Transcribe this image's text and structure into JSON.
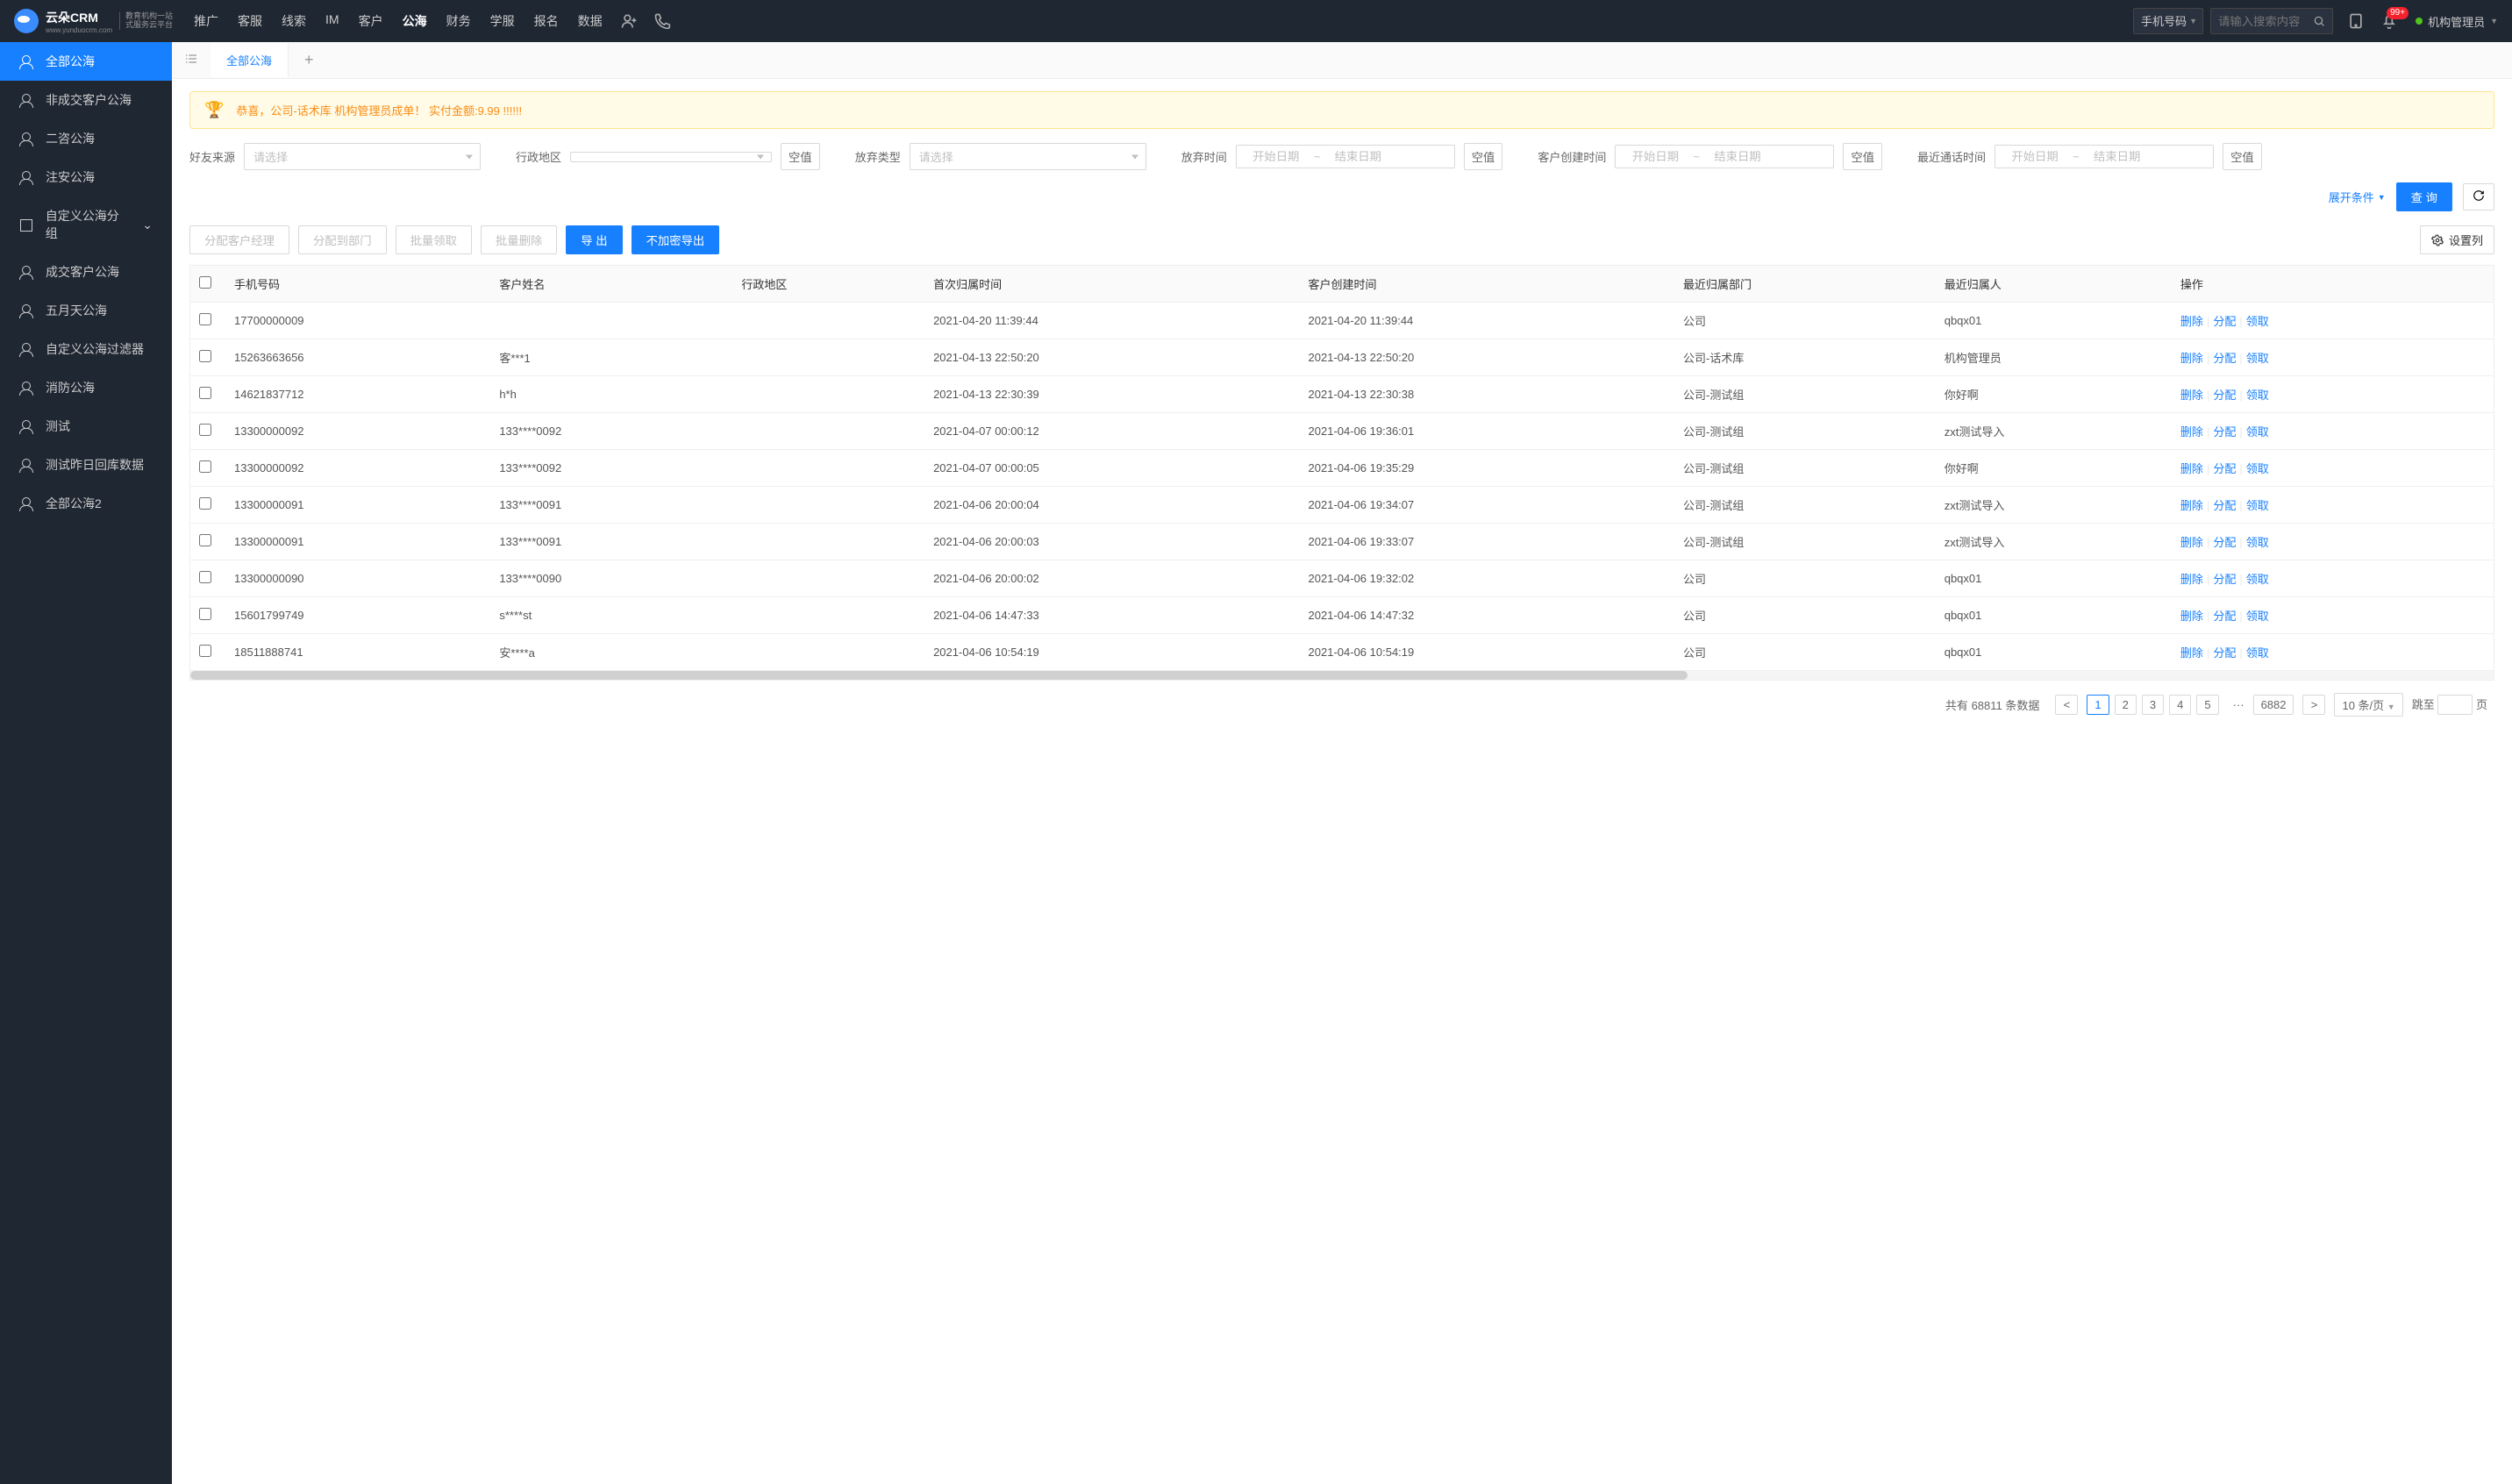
{
  "logo": {
    "brand": "云朵CRM",
    "url": "www.yunduocrm.com",
    "sub1": "教育机构一站",
    "sub2": "式服务云平台"
  },
  "topnav": {
    "items": [
      "推广",
      "客服",
      "线索",
      "IM",
      "客户",
      "公海",
      "财务",
      "学服",
      "报名",
      "数据"
    ],
    "active_index": 5,
    "search_type": "手机号码",
    "search_placeholder": "请输入搜索内容",
    "user": "机构管理员",
    "badge": "99+"
  },
  "sidebar": {
    "items": [
      {
        "label": "全部公海",
        "icon": "people"
      },
      {
        "label": "非成交客户公海",
        "icon": "people"
      },
      {
        "label": "二咨公海",
        "icon": "people"
      },
      {
        "label": "注安公海",
        "icon": "people"
      },
      {
        "label": "自定义公海分组",
        "icon": "square",
        "expandable": true
      },
      {
        "label": "成交客户公海",
        "icon": "people"
      },
      {
        "label": "五月天公海",
        "icon": "people"
      },
      {
        "label": "自定义公海过滤器",
        "icon": "people"
      },
      {
        "label": "消防公海",
        "icon": "people"
      },
      {
        "label": "测试",
        "icon": "people"
      },
      {
        "label": "测试昨日回库数据",
        "icon": "people"
      },
      {
        "label": "全部公海2",
        "icon": "people"
      }
    ],
    "active_index": 0
  },
  "tab": {
    "label": "全部公海"
  },
  "banner": "恭喜，公司-话术库  机构管理员成单！  实付金额:9.99 !!!!!!",
  "filters": {
    "friend_source": {
      "label": "好友来源",
      "placeholder": "请选择"
    },
    "admin_region": {
      "label": "行政地区",
      "placeholder": "",
      "null_btn": "空值"
    },
    "abandon_type": {
      "label": "放弃类型",
      "placeholder": "请选择"
    },
    "abandon_time": {
      "label": "放弃时间",
      "start": "开始日期",
      "end": "结束日期",
      "null_btn": "空值"
    },
    "create_time": {
      "label": "客户创建时间",
      "start": "开始日期",
      "end": "结束日期",
      "null_btn": "空值"
    },
    "last_call": {
      "label": "最近通话时间",
      "start": "开始日期",
      "end": "结束日期",
      "null_btn": "空值"
    },
    "expand": "展开条件",
    "query": "查 询"
  },
  "actions": {
    "assign_mgr": "分配客户经理",
    "assign_dept": "分配到部门",
    "batch_claim": "批量领取",
    "batch_delete": "批量删除",
    "export": "导 出",
    "export_plain": "不加密导出",
    "col_settings": "设置列"
  },
  "table": {
    "headers": [
      "手机号码",
      "客户姓名",
      "行政地区",
      "首次归属时间",
      "客户创建时间",
      "最近归属部门",
      "最近归属人",
      "操作"
    ],
    "row_actions": {
      "delete": "删除",
      "assign": "分配",
      "claim": "领取"
    },
    "rows": [
      {
        "phone": "17700000009",
        "name": "",
        "region": "",
        "first_time": "2021-04-20 11:39:44",
        "create_time": "2021-04-20 11:39:44",
        "dept": "公司",
        "owner": "qbqx01"
      },
      {
        "phone": "15263663656",
        "name": "客***1",
        "region": "",
        "first_time": "2021-04-13 22:50:20",
        "create_time": "2021-04-13 22:50:20",
        "dept": "公司-话术库",
        "owner": "机构管理员"
      },
      {
        "phone": "14621837712",
        "name": "h*h",
        "region": "",
        "first_time": "2021-04-13 22:30:39",
        "create_time": "2021-04-13 22:30:38",
        "dept": "公司-测试组",
        "owner": "你好啊"
      },
      {
        "phone": "13300000092",
        "name": "133****0092",
        "region": "",
        "first_time": "2021-04-07 00:00:12",
        "create_time": "2021-04-06 19:36:01",
        "dept": "公司-测试组",
        "owner": "zxt测试导入"
      },
      {
        "phone": "13300000092",
        "name": "133****0092",
        "region": "",
        "first_time": "2021-04-07 00:00:05",
        "create_time": "2021-04-06 19:35:29",
        "dept": "公司-测试组",
        "owner": "你好啊"
      },
      {
        "phone": "13300000091",
        "name": "133****0091",
        "region": "",
        "first_time": "2021-04-06 20:00:04",
        "create_time": "2021-04-06 19:34:07",
        "dept": "公司-测试组",
        "owner": "zxt测试导入"
      },
      {
        "phone": "13300000091",
        "name": "133****0091",
        "region": "",
        "first_time": "2021-04-06 20:00:03",
        "create_time": "2021-04-06 19:33:07",
        "dept": "公司-测试组",
        "owner": "zxt测试导入"
      },
      {
        "phone": "13300000090",
        "name": "133****0090",
        "region": "",
        "first_time": "2021-04-06 20:00:02",
        "create_time": "2021-04-06 19:32:02",
        "dept": "公司",
        "owner": "qbqx01"
      },
      {
        "phone": "15601799749",
        "name": "s****st",
        "region": "",
        "first_time": "2021-04-06 14:47:33",
        "create_time": "2021-04-06 14:47:32",
        "dept": "公司",
        "owner": "qbqx01"
      },
      {
        "phone": "18511888741",
        "name": "安****a",
        "region": "",
        "first_time": "2021-04-06 10:54:19",
        "create_time": "2021-04-06 10:54:19",
        "dept": "公司",
        "owner": "qbqx01"
      }
    ]
  },
  "pagination": {
    "total_prefix": "共有",
    "total": "68811",
    "total_suffix": "条数据",
    "pages": [
      "1",
      "2",
      "3",
      "4",
      "5"
    ],
    "ellipsis": "···",
    "last": "6882",
    "size": "10 条/页",
    "jump_label": "跳至",
    "jump_suffix": "页"
  }
}
